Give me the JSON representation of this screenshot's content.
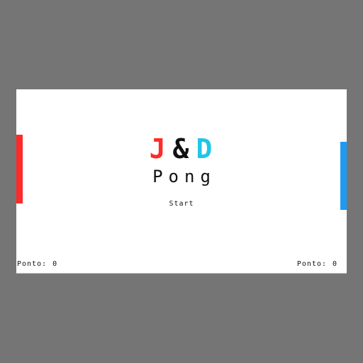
{
  "colors": {
    "background": "#757575",
    "canvas": "#ffffff",
    "player1": "#ff2a2a",
    "player2": "#1e9af0",
    "text": "#111111"
  },
  "title": {
    "letter1": "J",
    "ampersand": "&",
    "letter2": "D",
    "subtitle": "Pong"
  },
  "menu": {
    "start_label": "Start"
  },
  "scores": {
    "left": {
      "label": "Ponto:",
      "value": "0"
    },
    "right": {
      "label": "Ponto:",
      "value": "0"
    }
  }
}
